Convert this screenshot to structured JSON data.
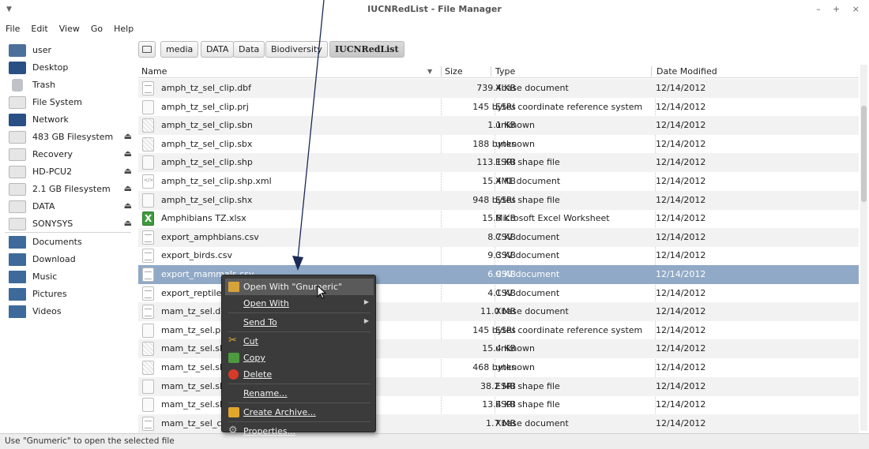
{
  "window": {
    "title": "IUCNRedList - File Manager",
    "menu_glyph": "▼",
    "controls": "– + ×"
  },
  "menubar": [
    "File",
    "Edit",
    "View",
    "Go",
    "Help"
  ],
  "sidebar": [
    {
      "label": "user",
      "icon": "user-home-icon"
    },
    {
      "label": "Desktop",
      "icon": "desktop-icon"
    },
    {
      "label": "Trash",
      "icon": "trash-icon"
    },
    {
      "label": "File System",
      "icon": "drive-icon"
    },
    {
      "label": "Network",
      "icon": "network-icon"
    },
    {
      "label": "483 GB Filesystem",
      "icon": "drive-icon",
      "eject": "⏏"
    },
    {
      "label": "Recovery",
      "icon": "drive-icon",
      "eject": "⏏"
    },
    {
      "label": "HD-PCU2",
      "icon": "drive-icon",
      "eject": "⏏"
    },
    {
      "label": "2.1 GB Filesystem",
      "icon": "drive-icon",
      "eject": "⏏"
    },
    {
      "label": "DATA",
      "icon": "drive-icon",
      "eject": "⏏"
    },
    {
      "label": "SONYSYS",
      "icon": "drive-icon",
      "eject": "⏏"
    },
    {
      "label": "Documents",
      "icon": "folder-icon"
    },
    {
      "label": "Download",
      "icon": "folder-icon"
    },
    {
      "label": "Music",
      "icon": "folder-icon"
    },
    {
      "label": "Pictures",
      "icon": "folder-icon"
    },
    {
      "label": "Videos",
      "icon": "folder-icon"
    }
  ],
  "breadcrumb": [
    "media",
    "DATA",
    "Data",
    "Biodiversity",
    "IUCNRedList"
  ],
  "columns": {
    "name": "Name",
    "size": "Size",
    "type": "Type",
    "date": "Date Modified",
    "sort_glyph": "▼"
  },
  "files": [
    {
      "name": "amph_tz_sel_clip.dbf",
      "size": "739.4 KB",
      "type": "Xbase document",
      "date": "12/14/2012",
      "icon": "text"
    },
    {
      "name": "amph_tz_sel_clip.prj",
      "size": "145 bytes",
      "type": "ESRI coordinate reference system",
      "date": "12/14/2012",
      "icon": "plain"
    },
    {
      "name": "amph_tz_sel_clip.sbn",
      "size": "1.1 KB",
      "type": "unknown",
      "date": "12/14/2012",
      "icon": "noise"
    },
    {
      "name": "amph_tz_sel_clip.sbx",
      "size": "188 bytes",
      "type": "unknown",
      "date": "12/14/2012",
      "icon": "noise"
    },
    {
      "name": "amph_tz_sel_clip.shp",
      "size": "113.1 KB",
      "type": "ESRI shape file",
      "date": "12/14/2012",
      "icon": "plain"
    },
    {
      "name": "amph_tz_sel_clip.shp.xml",
      "size": "15.4 KB",
      "type": "XML document",
      "date": "12/14/2012",
      "icon": "xml"
    },
    {
      "name": "amph_tz_sel_clip.shx",
      "size": "948 bytes",
      "type": "ESRI shape file",
      "date": "12/14/2012",
      "icon": "plain"
    },
    {
      "name": "Amphibians TZ.xlsx",
      "size": "15.8 KB",
      "type": "Microsoft Excel Worksheet",
      "date": "12/14/2012",
      "icon": "excel"
    },
    {
      "name": "export_amphbians.csv",
      "size": "8.7 KB",
      "type": "CSV document",
      "date": "12/14/2012",
      "icon": "text"
    },
    {
      "name": "export_birds.csv",
      "size": "9.3 KB",
      "type": "CSV document",
      "date": "12/14/2012",
      "icon": "text"
    },
    {
      "name": "export_mammals.csv",
      "size": "6.9 KB",
      "type": "CSV document",
      "date": "12/14/2012",
      "icon": "text",
      "selected": true
    },
    {
      "name": "export_reptiles.csv",
      "size": "4.1 KB",
      "type": "CSV document",
      "date": "12/14/2012",
      "icon": "text"
    },
    {
      "name": "mam_tz_sel.dbf",
      "size": "11.0 MB",
      "type": "Xbase document",
      "date": "12/14/2012",
      "icon": "text"
    },
    {
      "name": "mam_tz_sel.prj",
      "size": "145 bytes",
      "type": "ESRI coordinate reference system",
      "date": "12/14/2012",
      "icon": "plain"
    },
    {
      "name": "mam_tz_sel.sbn",
      "size": "15.4 KB",
      "type": "unknown",
      "date": "12/14/2012",
      "icon": "noise"
    },
    {
      "name": "mam_tz_sel.sbx",
      "size": "468 bytes",
      "type": "unknown",
      "date": "12/14/2012",
      "icon": "noise"
    },
    {
      "name": "mam_tz_sel.shp",
      "size": "38.2 MB",
      "type": "ESRI shape file",
      "date": "12/14/2012",
      "icon": "plain"
    },
    {
      "name": "mam_tz_sel.shx",
      "size": "13.4 KB",
      "type": "ESRI shape file",
      "date": "12/14/2012",
      "icon": "plain"
    },
    {
      "name": "mam_tz_sel_clip.dbf",
      "size": "1.7 MB",
      "type": "Xbase document",
      "date": "12/14/2012",
      "icon": "text"
    }
  ],
  "context_menu": [
    {
      "label": "Open With \"Gnumeric\"",
      "icon": "open-folder-icon",
      "highlight": true
    },
    {
      "label": "Open With",
      "submenu": true
    },
    {
      "label": "Send To",
      "submenu": true,
      "separator_before": true
    },
    {
      "label": "Cut",
      "icon": "scissors-icon",
      "separator_before": true
    },
    {
      "label": "Copy",
      "icon": "copy-icon"
    },
    {
      "label": "Delete",
      "icon": "delete-icon"
    },
    {
      "label": "Rename...",
      "separator_before": true
    },
    {
      "label": "Create Archive...",
      "icon": "archive-icon",
      "separator_before": true
    },
    {
      "label": "Properties...",
      "icon": "gear-icon",
      "separator_before": true
    }
  ],
  "statusbar": {
    "text": "Use \"Gnumeric\" to open the selected file"
  },
  "colors": {
    "selected_row": "#90a9c6",
    "menu_bg": "#3b3b3b",
    "stripe": "#f2f2f2"
  }
}
